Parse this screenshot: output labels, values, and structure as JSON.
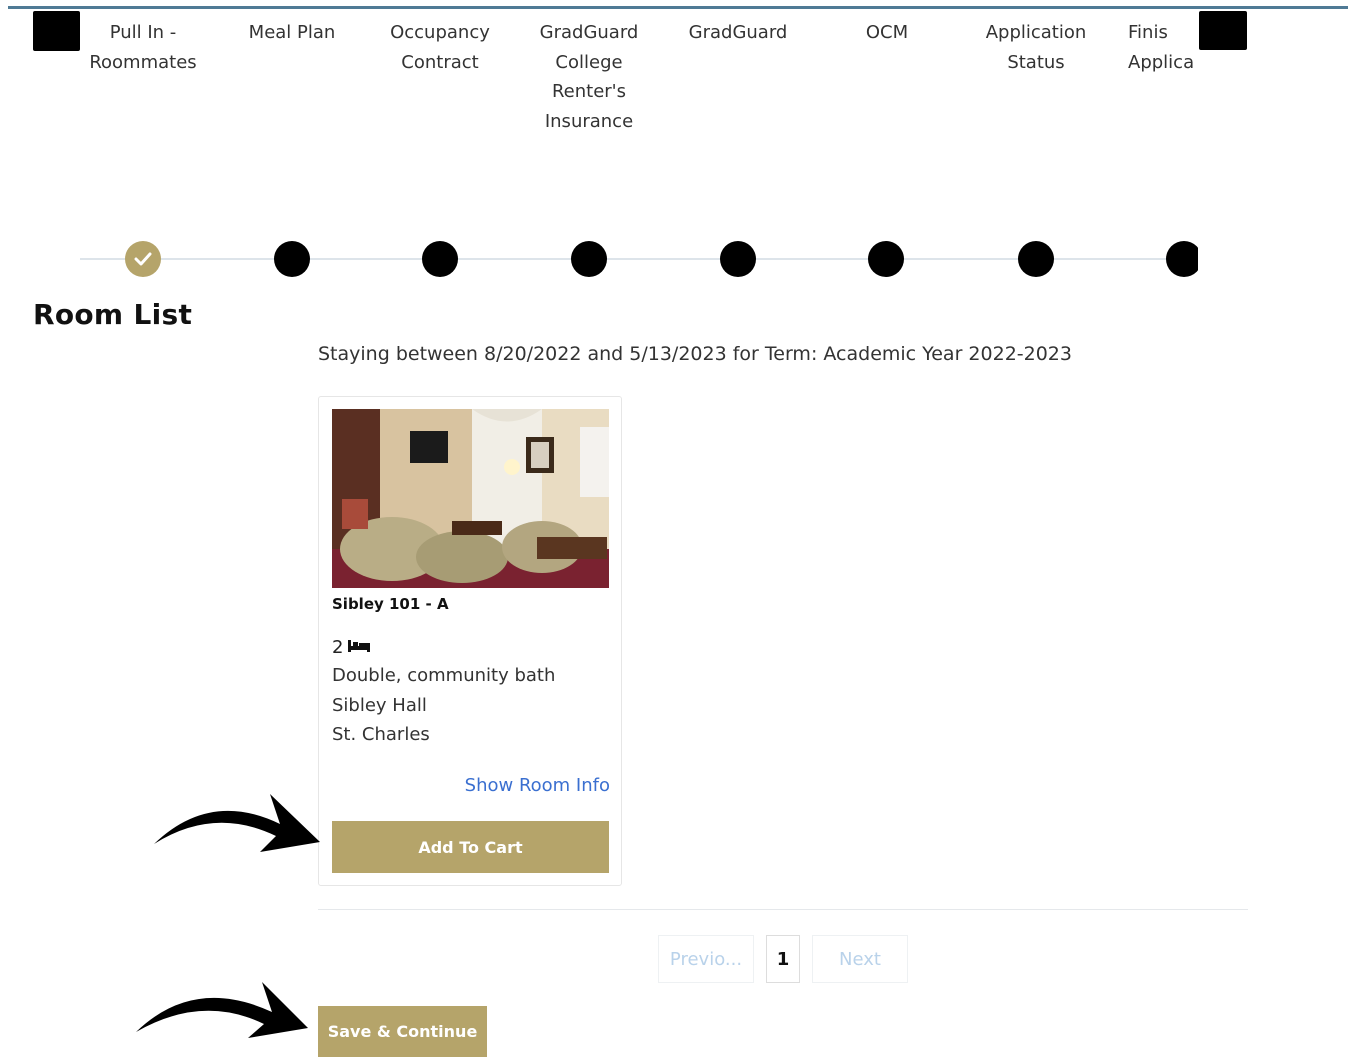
{
  "steps": [
    {
      "label": "Pull In -\nRoommates",
      "status": "complete"
    },
    {
      "label": "Meal Plan",
      "status": "pending"
    },
    {
      "label": "Occupancy\nContract",
      "status": "pending"
    },
    {
      "label": "GradGuard\nCollege\nRenter's\nInsurance",
      "status": "pending"
    },
    {
      "label": "GradGuard",
      "status": "pending"
    },
    {
      "label": "OCM",
      "status": "pending"
    },
    {
      "label": "Application\nStatus",
      "status": "pending"
    },
    {
      "label": "Finis\nApplica",
      "status": "pending"
    }
  ],
  "page_title": "Room List",
  "stay_text": "Staying between 8/20/2022 and 5/13/2023 for Term: Academic Year 2022-2023",
  "room": {
    "name": "Sibley 101 - A",
    "beds": "2",
    "bed_icon": "bed-icon",
    "type": "Double, community bath",
    "hall": "Sibley Hall",
    "campus": "St. Charles",
    "show_info_label": "Show Room Info",
    "add_to_cart_label": "Add To Cart"
  },
  "pagination": {
    "previous_label": "Previo...",
    "current_page": "1",
    "next_label": "Next"
  },
  "save_continue_label": "Save & Continue",
  "colors": {
    "accent_gold": "#b5a46a",
    "link_blue": "#3a6fd0",
    "step_done": "#b5a46a",
    "step_pending": "#000000"
  }
}
